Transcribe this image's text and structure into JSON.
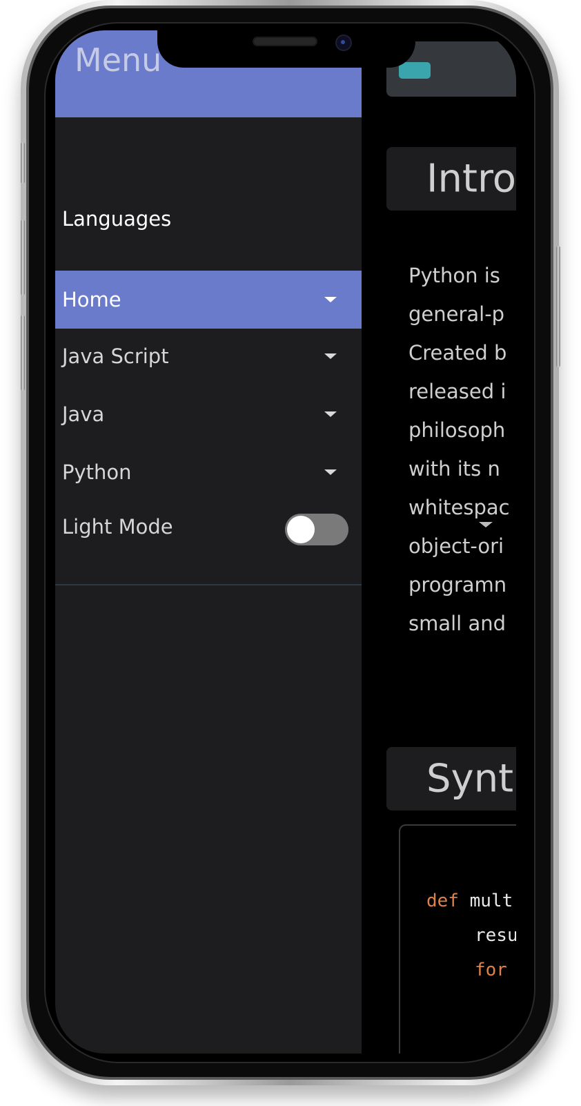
{
  "sidebar": {
    "title": "Menu",
    "section_label": "Languages",
    "items": [
      {
        "label": "Home",
        "active": true
      },
      {
        "label": "Java Script",
        "active": false
      },
      {
        "label": "Java",
        "active": false
      },
      {
        "label": "Python",
        "active": false
      }
    ],
    "light_mode_label": "Light Mode",
    "light_mode_on": false
  },
  "main": {
    "intro_heading": "Intro",
    "intro_lines": [
      "Python is",
      "general-p",
      "Created b",
      "released i",
      "philosoph",
      "with its n",
      "whitespac",
      "object-ori",
      "programn",
      "small and"
    ],
    "syntax_heading": "Synt",
    "code": [
      {
        "kw": "def",
        "rest": " mult"
      },
      {
        "kw": "",
        "rest": "resu"
      },
      {
        "kw": "for",
        "rest": ""
      }
    ]
  },
  "colors": {
    "accent": "#6a7bcc",
    "sidebar_bg": "#1d1d1f",
    "hamburger": "#3aa5ad",
    "code_keyword": "#e0804a"
  }
}
